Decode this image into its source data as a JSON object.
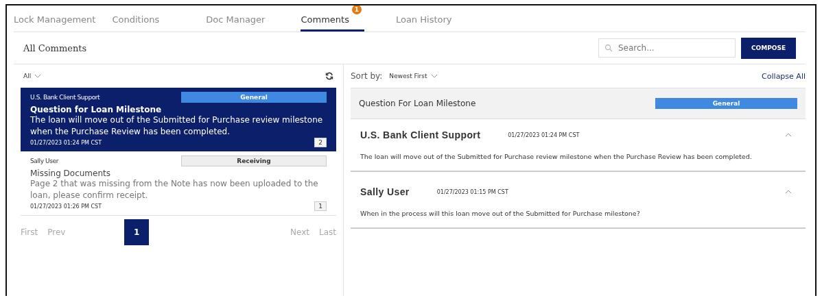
{
  "tabs": [
    {
      "label": "Lock Management",
      "selected": false
    },
    {
      "label": "Conditions",
      "selected": false
    },
    {
      "label": "Doc Manager",
      "selected": false
    },
    {
      "label": "Comments",
      "selected": true,
      "badge": "1"
    },
    {
      "label": "Loan History",
      "selected": false
    }
  ],
  "title": "All Comments",
  "search": {
    "placeholder": "Search..."
  },
  "compose_button": "COMPOSE",
  "filter": "All",
  "comments": [
    {
      "author": "U.S. Bank Client Support",
      "tag": "General",
      "color": "#3f8ae0",
      "subject": "Question for Loan Milestone",
      "body": "The loan will move out of the Submitted for Purchase review milestone when the Purchase Review has been completed.",
      "time": "01/27/2023 01:24 PM CST",
      "count": "2",
      "selected": true
    },
    {
      "author": "Sally User",
      "tag": "Receiving",
      "color": "#eeeeee",
      "subject": "Missing Documents",
      "body": "Page 2 that was missing from the Note has now been uploaded to the loan, please confirm receipt.",
      "time": "01/27/2023 01:26 PM CST",
      "count": "1",
      "selected": false
    }
  ],
  "pagination": {
    "first": "First",
    "prev": "Prev",
    "pages": [
      {
        "label": "1",
        "selected": true
      }
    ],
    "next": "Next",
    "last": "Last"
  },
  "sort": {
    "label": "Sort by:",
    "value": "Newest First"
  },
  "collapse_all": "Collapse All",
  "thread": {
    "subject": "Question For Loan Milestone",
    "tag": "General",
    "color": "#3f8ae0",
    "messages": [
      {
        "author": "U.S. Bank Client Support",
        "time": "01/27/2023 01:24 PM CST",
        "body": "The loan will move out of the Submitted for Purchase review milestone when the Purchase Review has been completed.",
        "expanded": true
      },
      {
        "author": "Sally User",
        "time": "01/27/2023 01:15 PM CST",
        "body": "When in the process will this loan move out of the Submitted for Purchase milestone?",
        "expanded": true
      }
    ]
  }
}
